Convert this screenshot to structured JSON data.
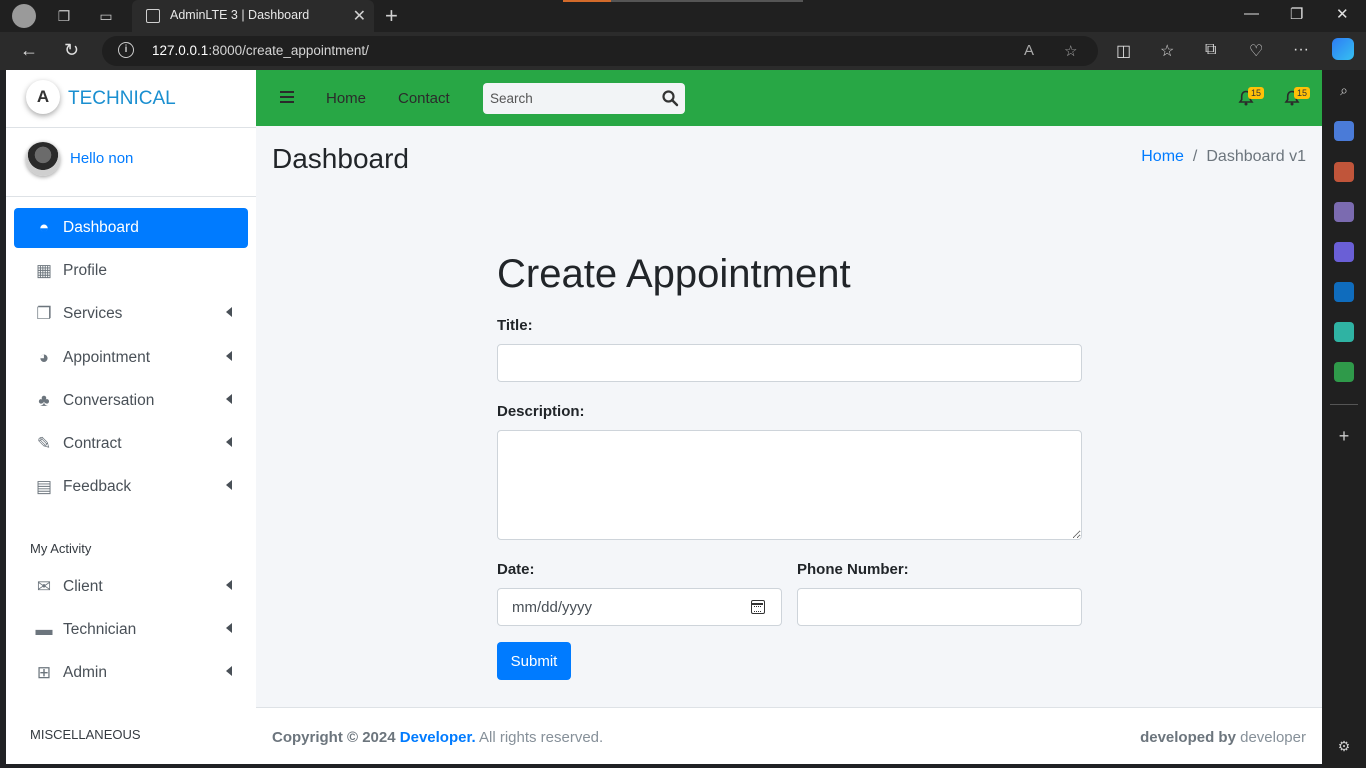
{
  "browser": {
    "tab_title": "AdminLTE 3 | Dashboard",
    "url_host": "127.0.0.1",
    "url_rest": ":8000/create_appointment/"
  },
  "sidebar": {
    "brand": "TECHNICAL",
    "brand_logo": "A",
    "user_name": "Hello non",
    "items": [
      {
        "label": "Dashboard",
        "icon": "tachometer-icon",
        "active": true
      },
      {
        "label": "Profile",
        "icon": "grid-icon"
      },
      {
        "label": "Services",
        "icon": "copy-icon",
        "arrow": true
      },
      {
        "label": "Appointment",
        "icon": "chart-pie-icon",
        "arrow": true
      },
      {
        "label": "Conversation",
        "icon": "tree-icon",
        "arrow": true
      },
      {
        "label": "Contract",
        "icon": "edit-icon",
        "arrow": true
      },
      {
        "label": "Feedback",
        "icon": "table-icon",
        "arrow": true
      }
    ],
    "header_activity": "My Activity",
    "activity_items": [
      {
        "label": "Client",
        "icon": "envelope-icon"
      },
      {
        "label": "Technician",
        "icon": "book-icon"
      },
      {
        "label": "Admin",
        "icon": "plus-square-icon"
      }
    ],
    "header_misc": "MISCELLANEOUS"
  },
  "topnav": {
    "home": "Home",
    "contact": "Contact",
    "search_placeholder": "Search",
    "badge1": "15",
    "badge2": "15"
  },
  "page": {
    "title": "Dashboard",
    "breadcrumb_home": "Home",
    "breadcrumb_current": "Dashboard v1"
  },
  "form": {
    "heading": "Create Appointment",
    "title_label": "Title:",
    "description_label": "Description:",
    "date_label": "Date:",
    "date_placeholder": "mm/dd/yyyy",
    "phone_label": "Phone Number:",
    "submit": "Submit"
  },
  "footer": {
    "copyright": "Copyright © 2024",
    "developer": "Developer.",
    "rights": "All rights reserved.",
    "developed_by": "developed by",
    "developer_name": "developer"
  },
  "colors": {
    "navbar": "#28a745",
    "primary": "#007bff",
    "badge": "#ffc107"
  }
}
